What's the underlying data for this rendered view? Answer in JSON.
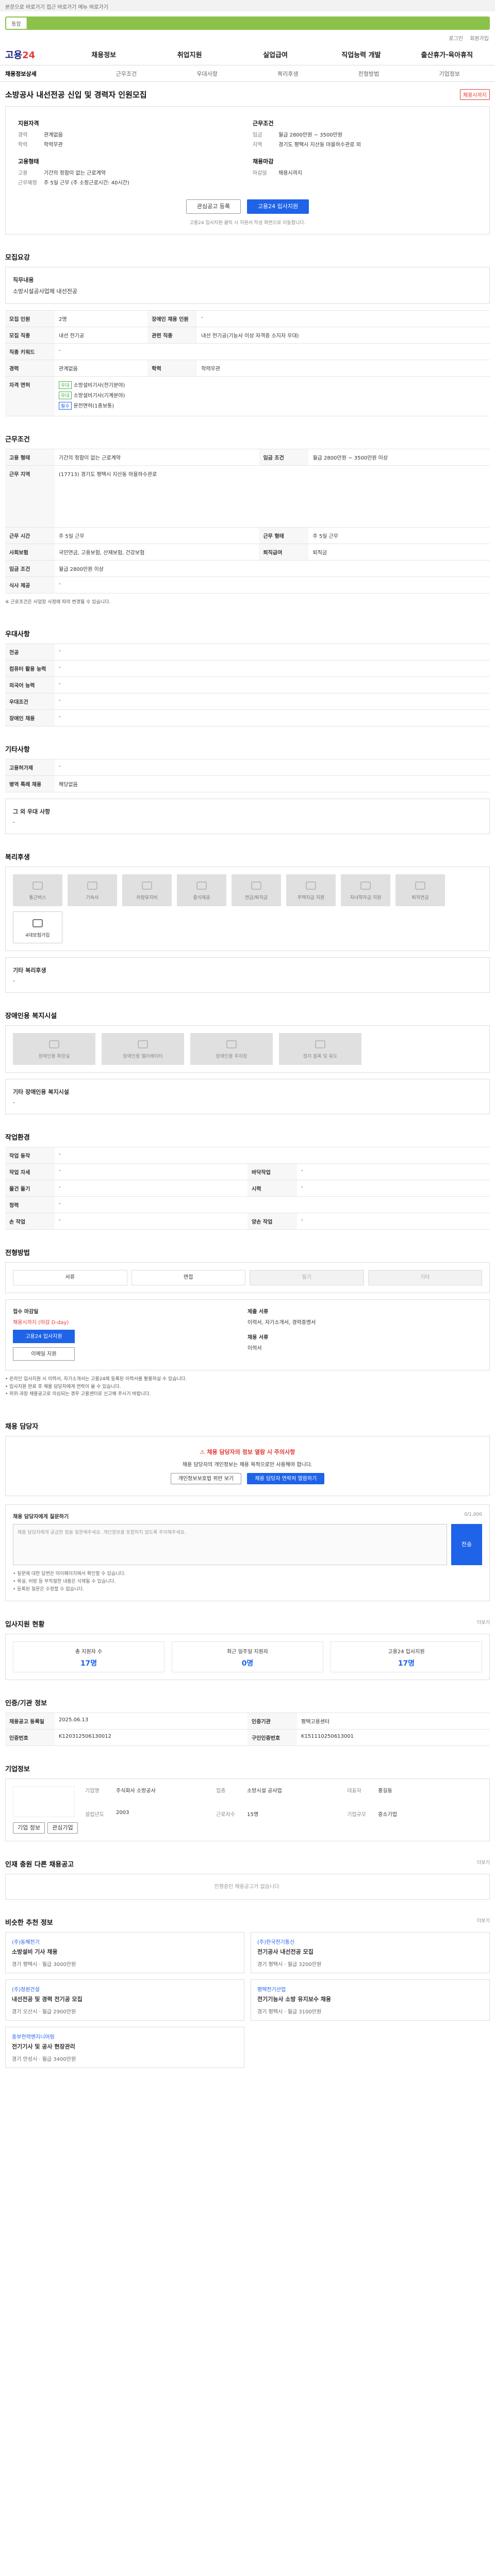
{
  "notice": "본문으로 바로가기 접근 바로가기 메뉴 바로가기",
  "search": {
    "scope": "통합"
  },
  "top_links": [
    "로그인",
    "회원가입"
  ],
  "logo": {
    "a": "고용",
    "b": "24"
  },
  "gnb": [
    "채용정보",
    "취업지원",
    "실업급여",
    "직업능력 개발",
    "출산휴가·육아휴직"
  ],
  "tabs": [
    "채용정보상세",
    "근무조건",
    "우대사항",
    "복리후생",
    "전형방법",
    "기업정보"
  ],
  "job": {
    "title": "소방공사 내선전공 신입 및 경력자 인원모집",
    "badge": "채용시까지"
  },
  "summary": {
    "left_head": "지원자격",
    "left_rows": [
      {
        "k": "경력",
        "v": "관계없음"
      },
      {
        "k": "학력",
        "v": "학력무관"
      }
    ],
    "left_head2": "고용형태",
    "left_rows2": [
      {
        "k": "고용",
        "v": "기간의 정함이 없는 근로계약"
      },
      {
        "k": "근무예정",
        "v": "주 5일 근무 (주 소정근로시간: 40시간)"
      }
    ],
    "right_head": "근무조건",
    "right_rows": [
      {
        "k": "임금",
        "v": "월급 2800만원 ~ 3500만원"
      },
      {
        "k": "지역",
        "v": "경기도 평택시 지산동 마을하수관로 외"
      }
    ],
    "right_head2": "채용마감",
    "right_rows2": [
      {
        "k": "마감일",
        "v": "채용시까지"
      }
    ],
    "btn_interest": "관심공고 등록",
    "btn_apply": "고용24 입사지원",
    "note": "고용24 입사지원 클릭 시 지원서 작성 화면으로 이동합니다."
  },
  "sec_recruit": {
    "title": "모집요강",
    "duty_label": "직무내용",
    "duty_value": "소방시설공사업체 내선전공",
    "rows": [
      [
        "모집 인원",
        "2명",
        "장애인 채용 인원",
        "-"
      ],
      [
        "모집 직종",
        "내선 전기공",
        "관련 직종",
        "내선 전기공(기능사 이상 자격증 소지자 우대)"
      ],
      [
        "직종 키워드",
        "-",
        "",
        ""
      ],
      [
        "경력",
        "관계없음",
        "학력",
        "학력무관"
      ]
    ],
    "license_label": "자격 면허",
    "licenses": [
      {
        "tag": "우대",
        "v": "소방설비기사(전기분야)"
      },
      {
        "tag": "우대",
        "v": "소방설비기사(기계분야)"
      },
      {
        "tag": "필수",
        "v": "운전면허(1종보통)"
      }
    ]
  },
  "sec_cond": {
    "title": "근무조건",
    "rows": [
      [
        "고용 형태",
        "기간의 정함이 없는 근로계약",
        "임금 조건",
        "월급 2800만원 ~ 3500만원 이상"
      ],
      [
        "근무 지역",
        "(17713) 경기도 평택시 지산동 마을하수관로",
        "",
        ""
      ],
      [
        "근무 시간",
        "주 5일 근무",
        "근무 형태",
        "주 5일 근무"
      ],
      [
        "사회보험",
        "국민연금, 고용보험, 산재보험, 건강보험",
        "퇴직급여",
        "퇴직금"
      ],
      [
        "임금 조건",
        "월급 2800만원 이상",
        "",
        ""
      ],
      [
        "식사 제공",
        "-",
        "",
        ""
      ]
    ],
    "note": "※ 근로조건은 사업장 사정에 따라 변경될 수 있습니다."
  },
  "sec_pref": {
    "title": "우대사항",
    "rows": [
      [
        "전공",
        "-"
      ],
      [
        "컴퓨터 활용 능력",
        "-"
      ],
      [
        "외국어 능력",
        "-"
      ],
      [
        "우대조건",
        "-"
      ],
      [
        "장애인 채용",
        "-"
      ]
    ]
  },
  "sec_etc": {
    "title": "기타사항",
    "rows": [
      [
        "고용허가제",
        "-"
      ],
      [
        "병역 특례 채용",
        "해당없음"
      ]
    ],
    "extra_label": "그 외 우대 사항",
    "extra_value": "-"
  },
  "sec_welfare": {
    "title": "복리후생",
    "items": [
      {
        "label": "통근버스",
        "on": false
      },
      {
        "label": "기숙사",
        "on": false
      },
      {
        "label": "차량유지비",
        "on": false
      },
      {
        "label": "중식제공",
        "on": false
      },
      {
        "label": "연금/퇴직금",
        "on": false
      },
      {
        "label": "주택자금 지원",
        "on": false
      },
      {
        "label": "자녀학자금 지원",
        "on": false
      },
      {
        "label": "퇴직연금",
        "on": false
      },
      {
        "label": "4대보험가입",
        "on": true
      }
    ],
    "extra_label": "기타 복리후생",
    "extra_value": "-"
  },
  "sec_disab": {
    "title": "장애인용 복지시설",
    "items": [
      "장애인용 화장실",
      "장애인용 엘리베이터",
      "장애인용 주차장",
      "점자 블록 및 유도"
    ],
    "extra_label": "기타 장애인용 복지시설",
    "extra_value": "-"
  },
  "sec_env": {
    "title": "작업환경",
    "rows": [
      [
        "작업 동작",
        "-",
        "",
        ""
      ],
      [
        "작업 자세",
        "-",
        "바닥작업",
        "-"
      ],
      [
        "물건 들기",
        "-",
        "시력",
        "-"
      ],
      [
        "청력",
        "-",
        "",
        ""
      ],
      [
        "손 작업",
        "-",
        "양손 작업",
        "-"
      ]
    ]
  },
  "sec_method": {
    "title": "전형방법",
    "items": [
      {
        "label": "서류",
        "on": true
      },
      {
        "label": "면접",
        "on": true
      },
      {
        "label": "필기",
        "on": false
      },
      {
        "label": "기타",
        "on": false
      }
    ]
  },
  "sec_apply": {
    "col1_head": "접수 마감일",
    "col1_red": "채용시까지 (마감 D-day)",
    "btn1": "고용24 입사지원",
    "btn2": "이메일 지원",
    "col2_head": "제출 서류",
    "col2_value": "이력서, 자기소개서, 경력증명서",
    "col2_head2": "채용 서류",
    "col2_value2": "이력서",
    "notes": [
      "• 온라인 입사지원 시 이력서, 자기소개서는 고용24에 등록된 이력서를 활용하실 수 있습니다.",
      "• 입사지원 완료 후 채용 담당자에게 연락이 올 수 있습니다.",
      "• 허위·과장 채용공고로 의심되는 경우 고용센터로 신고해 주시기 바랍니다."
    ]
  },
  "sec_contact": {
    "title": "채용 담당자",
    "alert_title": "채용 담당자의 정보 열람 시 주의사항",
    "alert_text": "채용 담당자의 개인정보는 채용 목적으로만 사용해야 합니다.",
    "btn1": "개인정보보호법 위반 보기",
    "btn2": "채용 담당자 연락처 열람하기"
  },
  "sec_qa": {
    "title": "채용 담당자에게 질문하기",
    "counter": "0/1,000",
    "placeholder": "채용 담당자에게 궁금한 점을 질문해주세요. 개인정보를 포함하지 않도록 주의해주세요.",
    "btn": "전송",
    "notes": [
      "• 질문에 대한 답변은 마이페이지에서 확인할 수 있습니다.",
      "• 욕설, 비방 등 부적절한 내용은 삭제될 수 있습니다.",
      "• 등록된 질문은 수정할 수 없습니다."
    ]
  },
  "sec_stat": {
    "title": "입사지원 현황",
    "more": "더보기",
    "items": [
      {
        "label": "총 지원자 수",
        "value": "17명"
      },
      {
        "label": "최근 일주일 지원자",
        "value": "0명"
      },
      {
        "label": "고용24 입사지원",
        "value": "17명"
      }
    ]
  },
  "sec_info": {
    "title": "인증/기관 정보",
    "rows": [
      [
        "채용공고 등록일",
        "2025.06.13",
        "인증기관",
        "평택고용센터"
      ],
      [
        "인증번호",
        "K120312506130012",
        "구인인증번호",
        "K151110250613001"
      ]
    ]
  },
  "sec_corp": {
    "title": "기업정보",
    "rows": [
      {
        "k": "기업명",
        "v": "주식회사 소방공사"
      },
      {
        "k": "업종",
        "v": "소방시설 공사업"
      },
      {
        "k": "대표자",
        "v": "홍길동"
      },
      {
        "k": "설립년도",
        "v": "2003"
      },
      {
        "k": "근로자수",
        "v": "15명"
      },
      {
        "k": "기업규모",
        "v": "중소기업"
      }
    ],
    "btn1": "기업 정보",
    "btn2": "관심기업"
  },
  "sec_same": {
    "title": "인재 충원 다른 채용공고",
    "more": "더보기",
    "empty": "진행중인 채용공고가 없습니다."
  },
  "sec_rec": {
    "title": "비슷한 추천 정보",
    "more": "더보기",
    "items": [
      {
        "company": "(주)동해전기",
        "title": "소방설비 기사 채용",
        "meta": "경기 평택시 · 월급 3000만원"
      },
      {
        "company": "(주)한국전기통신",
        "title": "전기공사 내선전공 모집",
        "meta": "경기 평택시 · 월급 3200만원"
      },
      {
        "company": "(주)청원건설",
        "title": "내선전공 및 경력 전기공 모집",
        "meta": "경기 오산시 · 월급 2900만원"
      },
      {
        "company": "평택전기산업",
        "title": "전기기능사 소방 유지보수 채용",
        "meta": "경기 평택시 · 월급 3100만원"
      },
      {
        "company": "중부전력엔지니어링",
        "title": "전기기사 및 공사 현장관리",
        "meta": "경기 안성시 · 월급 3400만원"
      }
    ]
  }
}
